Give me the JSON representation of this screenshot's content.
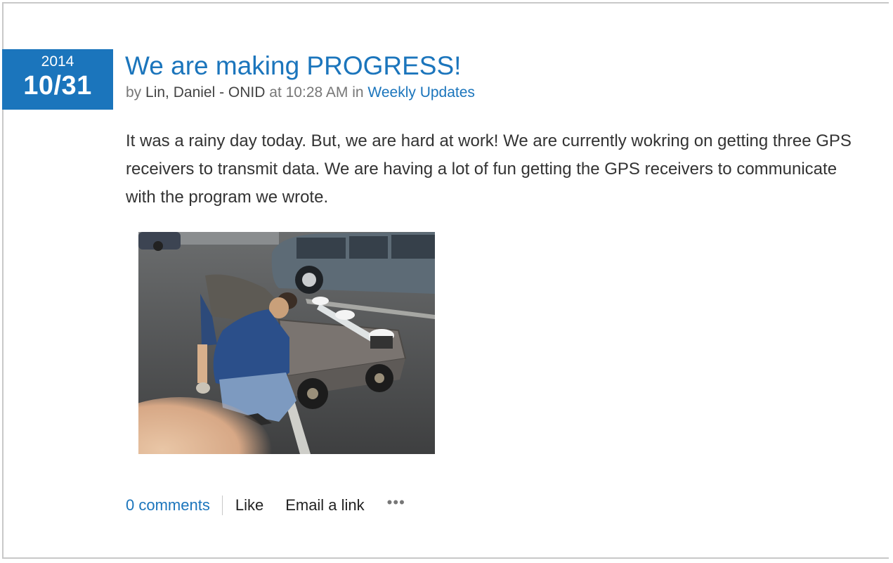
{
  "post": {
    "date": {
      "year": "2014",
      "day": "10/31"
    },
    "title": "We are making PROGRESS!",
    "byline": {
      "by_label": "by",
      "author": "Lin, Daniel - ONID",
      "at_label": "at",
      "time": "10:28 AM",
      "in_label": "in",
      "category": "Weekly Updates"
    },
    "body": "It was a rainy day today. But, we are hard at work! We are currently wokring on getting three GPS receivers to transmit data. We are having a lot of fun getting the GPS receivers to communicate with the program we wrote.",
    "image": {
      "icon": "photo-image"
    }
  },
  "actions": {
    "comments": "0 comments",
    "like": "Like",
    "email": "Email a link",
    "more_icon": "ellipsis-icon"
  },
  "colors": {
    "accent": "#1b75bc",
    "text": "#333333",
    "meta": "#777777"
  }
}
